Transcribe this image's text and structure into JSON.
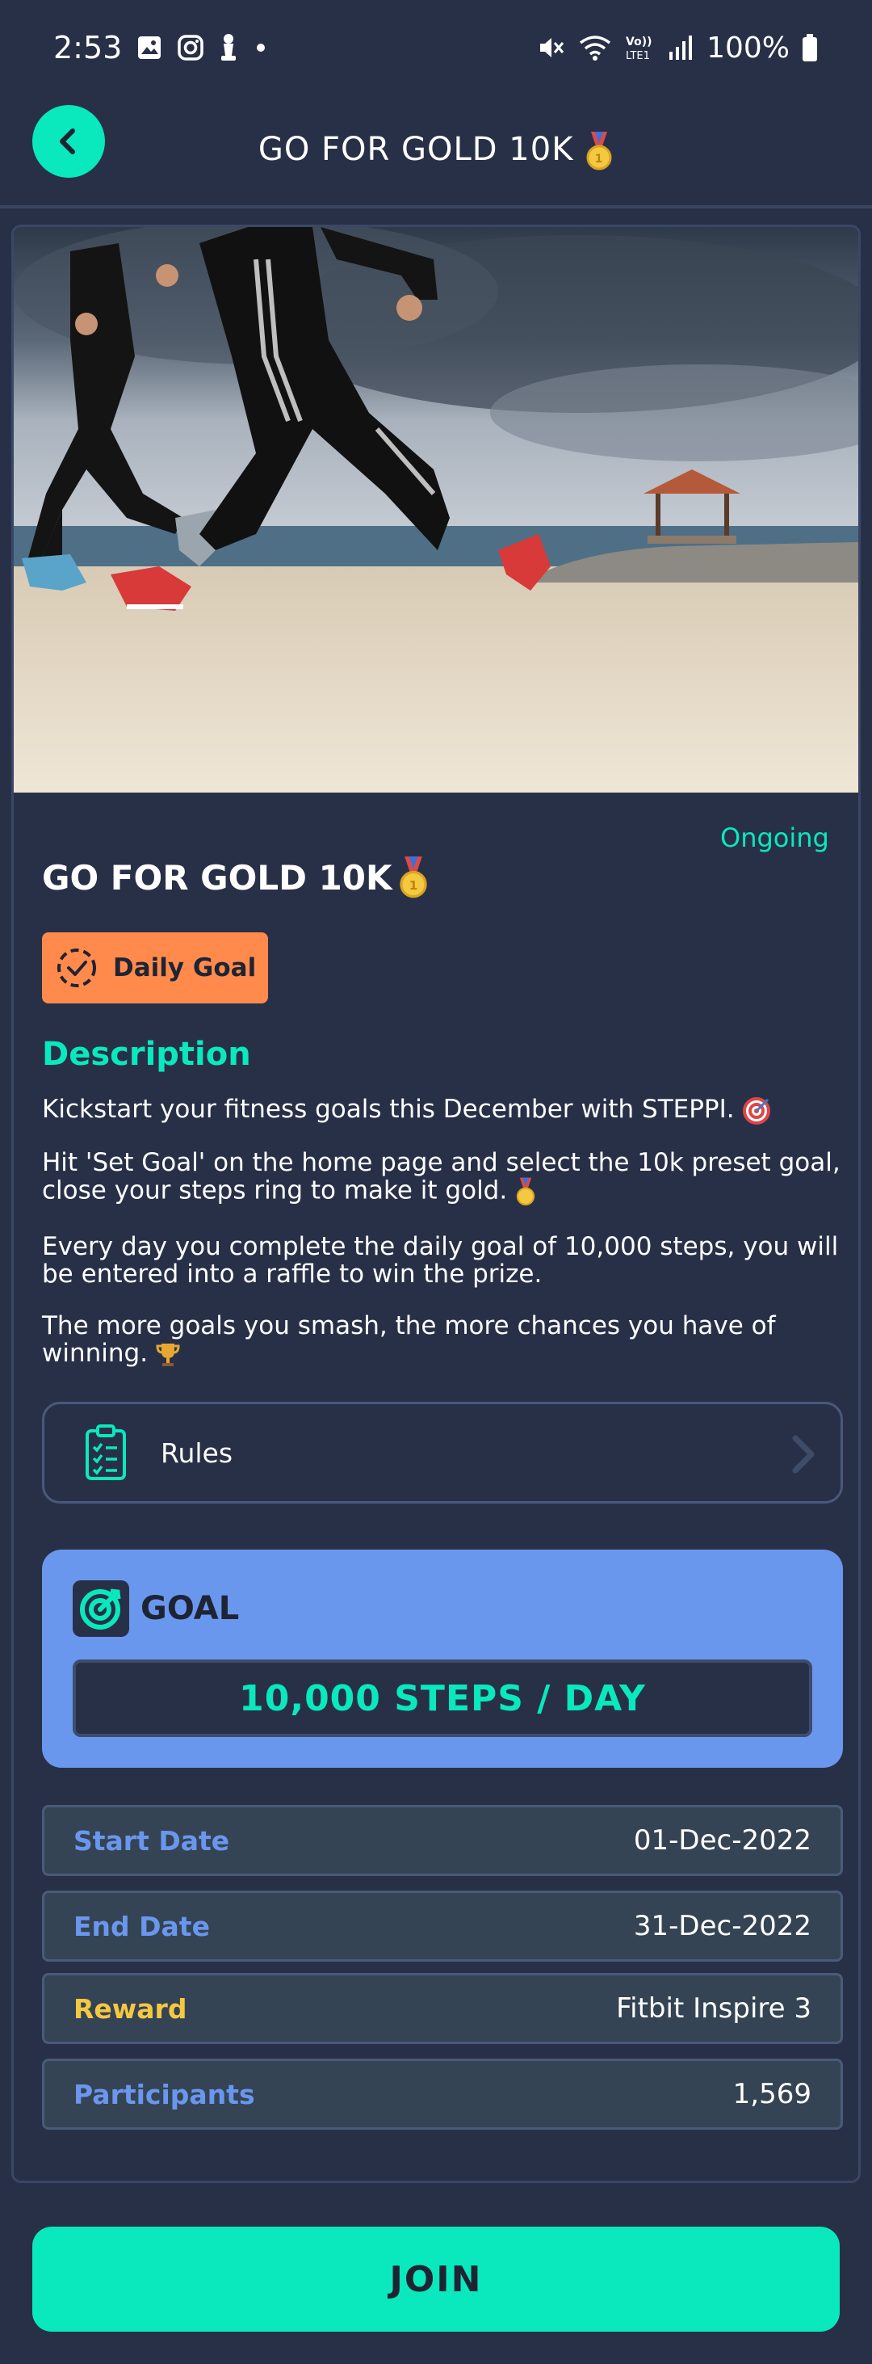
{
  "status_bar": {
    "time": "2:53",
    "battery": "100%"
  },
  "header": {
    "title": "GO FOR GOLD 10K",
    "back_icon": "chevron-left-icon"
  },
  "challenge": {
    "status": "Ongoing",
    "title": "GO FOR GOLD 10K",
    "badge_label": "Daily Goal",
    "description_heading": "Description",
    "paragraphs": [
      "Kickstart your fitness goals this December with STEPPI.",
      "Hit 'Set Goal' on the home page and select the 10k preset goal, close your steps ring to make it gold.",
      "Every day you complete the daily goal of 10,000 steps, you will be entered into a raffle to win the prize.",
      "The more goals you smash, the more chances you have of winning."
    ],
    "rules_label": "Rules"
  },
  "goal": {
    "label": "GOAL",
    "value": "10,000 STEPS / DAY"
  },
  "info": [
    {
      "label": "Start Date",
      "value": "01-Dec-2022"
    },
    {
      "label": "End Date",
      "value": "31-Dec-2022"
    },
    {
      "label": "Reward",
      "value": "Fitbit Inspire 3"
    },
    {
      "label": "Participants",
      "value": "1,569"
    }
  ],
  "join_label": "JOIN",
  "colors": {
    "background": "#283048",
    "accent": "#0ae8bd",
    "goal_card": "#6a97ee",
    "badge": "#ff8a4c",
    "reward": "#f5c842"
  }
}
